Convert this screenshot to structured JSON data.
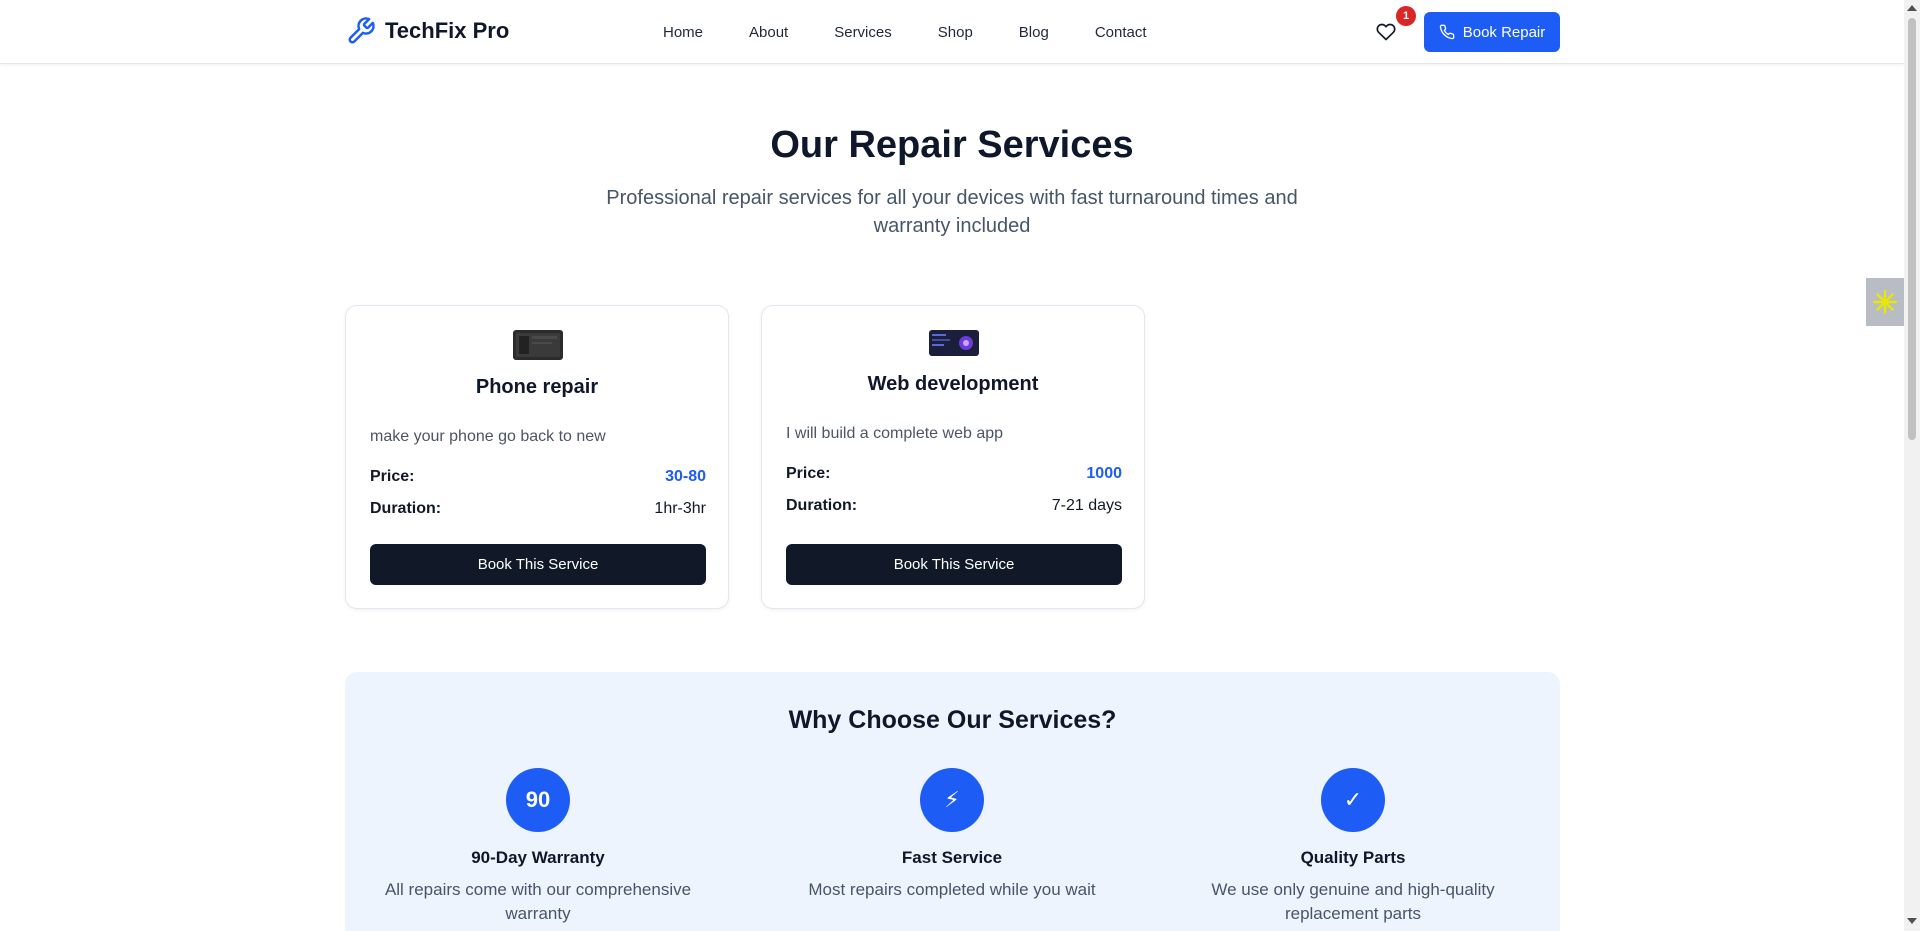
{
  "header": {
    "brand": "TechFix Pro",
    "brand_icon": "wrench-icon",
    "nav": [
      "Home",
      "About",
      "Services",
      "Shop",
      "Blog",
      "Contact"
    ],
    "wishlist_icon": "heart-icon",
    "wishlist_count": "1",
    "book_button": "Book Repair",
    "book_button_icon": "phone-icon"
  },
  "hero": {
    "title": "Our Repair Services",
    "subtitle": "Professional repair services for all your devices with fast turnaround times and warranty included"
  },
  "services": [
    {
      "title": "Phone repair",
      "description": "make your phone go back to new",
      "price_label": "Price:",
      "price": "30-80",
      "duration_label": "Duration:",
      "duration": "1hr-3hr",
      "button": "Book This Service"
    },
    {
      "title": "Web development",
      "description": "I will build a complete web app",
      "price_label": "Price:",
      "price": "1000",
      "duration_label": "Duration:",
      "duration": "7-21 days",
      "button": "Book This Service"
    }
  ],
  "why": {
    "title": "Why Choose Our Services?",
    "features": [
      {
        "icon_text": "90",
        "title": "90-Day Warranty",
        "description": "All repairs come with our comprehensive warranty"
      },
      {
        "icon_text": "⚡",
        "title": "Fast Service",
        "description": "Most repairs completed while you wait"
      },
      {
        "icon_text": "✓",
        "title": "Quality Parts",
        "description": "We use only genuine and high-quality replacement parts"
      }
    ]
  },
  "colors": {
    "accent": "#1d5cf5",
    "dark_button": "#111827",
    "why_background": "#eef4fe",
    "badge": "#dc2626"
  }
}
